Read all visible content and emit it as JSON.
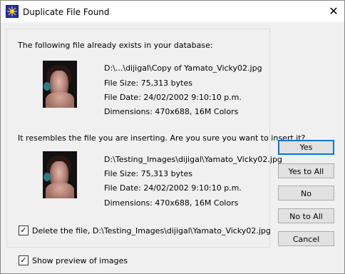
{
  "window": {
    "title": "Duplicate File Found",
    "close_glyph": "✕"
  },
  "message_existing": "The following file already exists in your database:",
  "existing_file": {
    "path": "D:\\...\\dijigal\\Copy of Yamato_Vicky02.jpg",
    "size": "File Size: 75,313 bytes",
    "date": "File Date: 24/02/2002 9:10:10 p.m.",
    "dimensions": "Dimensions: 470x688, 16M Colors"
  },
  "message_inserting": "It resembles the file you are inserting.  Are you sure you want to insert it?",
  "inserting_file": {
    "path": "D:\\Testing_Images\\dijigal\\Yamato_Vicky02.jpg",
    "size": "File Size: 75,313 bytes",
    "date": "File Date: 24/02/2002 9:10:10 p.m.",
    "dimensions": "Dimensions: 470x688, 16M Colors"
  },
  "delete_checkbox": {
    "checked": true,
    "check_glyph": "✓",
    "label": "Delete the file, D:\\Testing_Images\\dijigal\\Yamato_Vicky02.jpg"
  },
  "preview_checkbox": {
    "checked": true,
    "check_glyph": "✓",
    "label": "Show preview of images"
  },
  "buttons": {
    "yes": "Yes",
    "yes_to_all": "Yes to All",
    "no": "No",
    "no_to_all": "No to All",
    "cancel": "Cancel"
  },
  "icons": {
    "app": "starburst-app-icon",
    "close": "close-icon",
    "existing_thumbnail": "image-thumbnail",
    "inserting_thumbnail": "image-thumbnail"
  },
  "colors": {
    "default_button_border": "#0078d7",
    "app_icon_bg": "#1b2fb5"
  }
}
